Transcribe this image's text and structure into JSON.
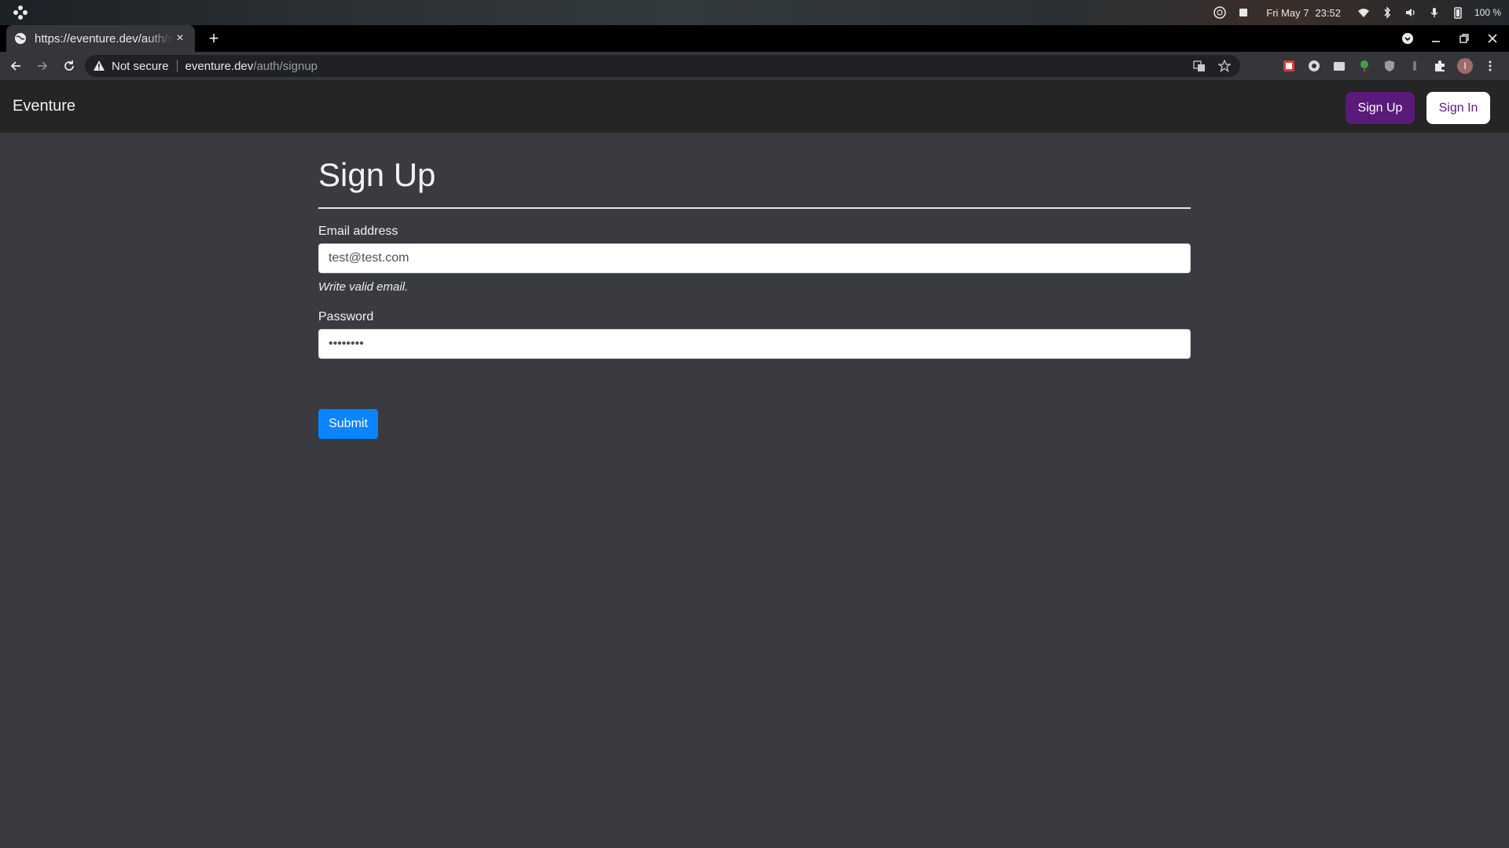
{
  "os": {
    "date": "Fri May 7",
    "time": "23:52",
    "battery": "100 %"
  },
  "browser": {
    "tab_title": "https://eventure.dev/auth/signup",
    "tab_close": "×",
    "new_tab": "+",
    "security_label": "Not secure",
    "url_host": "eventure.dev",
    "url_path": "/auth/signup"
  },
  "app": {
    "brand": "Eventure",
    "signup_label": "Sign Up",
    "signin_label": "Sign In"
  },
  "form": {
    "title": "Sign Up",
    "email_label": "Email address",
    "email_value": "test@test.com",
    "email_hint": "Write valid email.",
    "password_label": "Password",
    "password_value": "12345678",
    "submit_label": "Submit"
  },
  "colors": {
    "page_bg": "#3a3b40",
    "navbar_bg": "#252526",
    "brand_purple": "#5a1a7a",
    "submit_blue": "#0a84ff"
  }
}
